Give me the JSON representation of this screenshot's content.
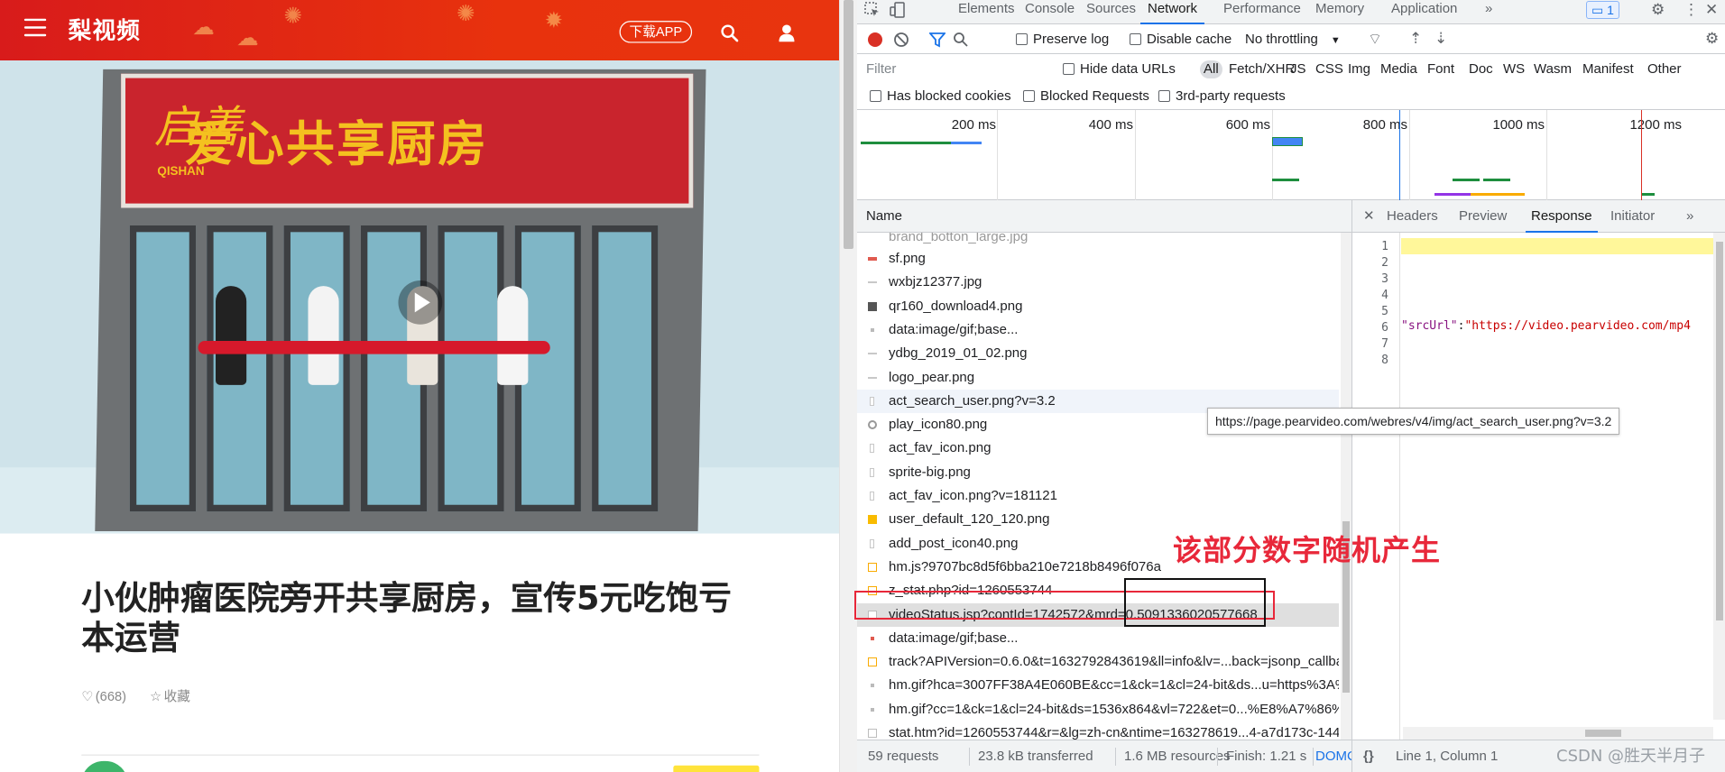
{
  "site": {
    "logo": "梨视频",
    "app_button": "下载APP",
    "article_title": "小伙肿瘤医院旁开共享厨房，宣传5元吃饱亏本运营",
    "likes": "(668)",
    "collect": "收藏",
    "video_sign": {
      "brand": "启善",
      "brand_en": "QISHAN",
      "title": "爱心共享厨房"
    }
  },
  "devtools": {
    "tabs": [
      "Elements",
      "Console",
      "Sources",
      "Network",
      "Performance",
      "Memory",
      "Application"
    ],
    "active_tab": "Network",
    "more_tabs": "»",
    "issues_badge": "1",
    "toolbar": {
      "preserve_log": "Preserve log",
      "disable_cache": "Disable cache",
      "throttling": "No throttling"
    },
    "filter": {
      "placeholder": "Filter",
      "hide_data_urls": "Hide data URLs",
      "types": [
        "All",
        "Fetch/XHR",
        "JS",
        "CSS",
        "Img",
        "Media",
        "Font",
        "Doc",
        "WS",
        "Wasm",
        "Manifest",
        "Other"
      ],
      "has_blocked_cookies": "Has blocked cookies",
      "blocked_requests": "Blocked Requests",
      "third_party": "3rd-party requests"
    },
    "timeline_ticks": [
      "200 ms",
      "400 ms",
      "600 ms",
      "800 ms",
      "1000 ms",
      "1200 ms"
    ],
    "name_header": "Name",
    "requests": [
      {
        "name": "sf.png",
        "icon": "red"
      },
      {
        "name": "wxbjz12377.jpg",
        "icon": "line"
      },
      {
        "name": "qr160_download4.png",
        "icon": "qr"
      },
      {
        "name": "data:image/gif;base...",
        "icon": "dot"
      },
      {
        "name": "ydbg_2019_01_02.png",
        "icon": "line"
      },
      {
        "name": "logo_pear.png",
        "icon": "line"
      },
      {
        "name": "act_search_user.png?v=3.2",
        "icon": "thin"
      },
      {
        "name": "play_icon80.png",
        "icon": "gear"
      },
      {
        "name": "act_fav_icon.png",
        "icon": "thin"
      },
      {
        "name": "sprite-big.png",
        "icon": "thin"
      },
      {
        "name": "act_fav_icon.png?v=181121",
        "icon": "thin"
      },
      {
        "name": "user_default_120_120.png",
        "icon": "yellow"
      },
      {
        "name": "add_post_icon40.png",
        "icon": "thin"
      },
      {
        "name": "hm.js?9707bc8d5f6bba210e7218b8496f076a",
        "icon": "js"
      },
      {
        "name": "z_stat.php?id=1260553744",
        "icon": "js"
      },
      {
        "name": "videoStatus.jsp?contId=1742572&mrd=0.5091336020577668",
        "icon": "doc"
      },
      {
        "name": "data:image/gif;base...",
        "icon": "reddot"
      },
      {
        "name": "track?APIVersion=0.6.0&t=1632792843619&ll=info&lv=...back=jsonp_callba",
        "icon": "js"
      },
      {
        "name": "hm.gif?hca=3007FF38A4E060BE&cc=1&ck=1&cl=24-bit&ds...u=https%3A%",
        "icon": "dot"
      },
      {
        "name": "hm.gif?cc=1&ck=1&cl=24-bit&ds=1536x864&vl=722&et=0...%E8%A7%86%",
        "icon": "dot"
      },
      {
        "name": "stat.htm?id=1260553744&r=&lg=zh-cn&ntime=163278619...4-a7d173c-144",
        "icon": "doc"
      }
    ],
    "detail_tabs": [
      "Headers",
      "Preview",
      "Response",
      "Initiator"
    ],
    "active_detail_tab": "Response",
    "code_lines": [
      "1",
      "2",
      "3",
      "4",
      "5",
      "6",
      "7",
      "8"
    ],
    "code_line6_key": "\"srcUrl\"",
    "code_line6_colon": ":",
    "code_line6_value": "\"https://video.pearvideo.com/mp4",
    "tooltip": "https://page.pearvideo.com/webres/v4/img/act_search_user.png?v=3.2",
    "status": {
      "requests": "59 requests",
      "transferred": "23.8 kB transferred",
      "resources": "1.6 MB resources",
      "finish": "Finish: 1.21 s",
      "domcontent": "DOMCc"
    },
    "code_status": "Line 1, Column 1",
    "code_status_icon": "{}"
  },
  "annotation": {
    "text": "该部分数字随机产生"
  },
  "watermark": "CSDN @胜天半月子",
  "colors": {
    "header_red": "#e0200f",
    "accent_blue": "#1a73e8",
    "annotation_red": "#e8283a"
  }
}
